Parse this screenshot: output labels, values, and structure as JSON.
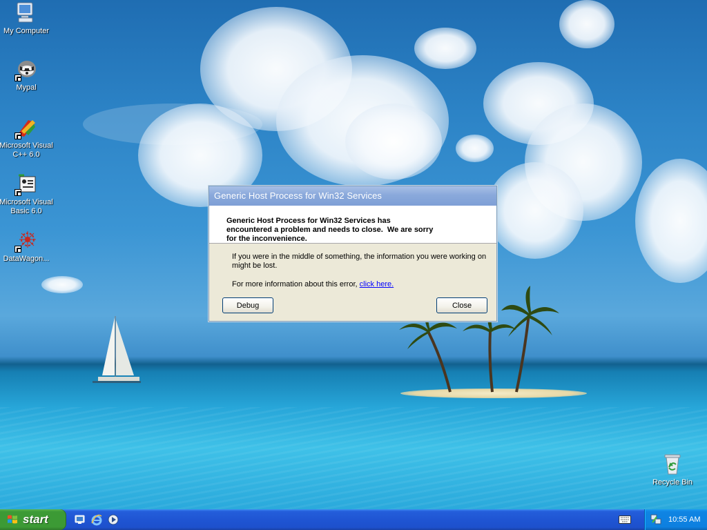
{
  "desktop": {
    "icons": [
      {
        "label": "My Computer",
        "icon": "my-computer-icon"
      },
      {
        "label": "Mypal",
        "icon": "mypal-browser-icon"
      },
      {
        "label": "Microsoft Visual C++ 6.0",
        "icon": "visual-cpp-icon"
      },
      {
        "label": "Microsoft Visual Basic 6.0",
        "icon": "visual-basic-icon"
      },
      {
        "label": "DataWagon...",
        "icon": "datawagon-icon"
      },
      {
        "label": "Recycle Bin",
        "icon": "recycle-bin-icon"
      }
    ]
  },
  "dialog": {
    "title": "Generic Host Process for Win32 Services",
    "heading_line1": "Generic Host Process for Win32 Services has",
    "heading_line2": "encountered a problem and needs to close.  We are sorry",
    "heading_line3": "for the inconvenience.",
    "body_line1": "If you were in the middle of something, the information you were working on",
    "body_line2": "might be lost.",
    "more_info": "For more information about this error, ",
    "link": "click here.",
    "debug_button": "Debug",
    "close_button": "Close"
  },
  "taskbar": {
    "start_label": "start",
    "quick_launch": [
      "show-desktop-icon",
      "internet-explorer-icon",
      "media-player-icon"
    ],
    "tray_icons": [
      "keyboard-language-icon",
      "network-icon"
    ],
    "clock": "10:55 AM"
  }
}
